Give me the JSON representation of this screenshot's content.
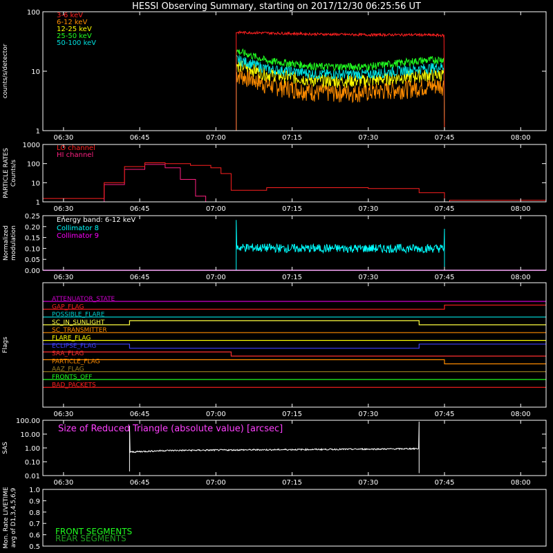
{
  "title": "HESSI Observing Summary, starting on 2017/12/30 06:25:56 UT",
  "time_axis_labels": [
    "06:30",
    "06:45",
    "07:00",
    "07:15",
    "07:30",
    "07:45",
    "08:00"
  ],
  "colors": {
    "background": "#000000",
    "axes": "#ffffff",
    "c3_6": "#ff2020",
    "c6_12": "#ff8c00",
    "c12_25": "#ffff00",
    "c25_50": "#20ff20",
    "c50_100": "#00e0e0",
    "lo": "#ff2020",
    "hi": "#ff2080",
    "coll8": "#00ffff",
    "coll9": "#ff00ff"
  },
  "chart_data": [
    {
      "type": "line",
      "panel": "count-rates",
      "title": "HESSI Observing Summary, starting on 2017/12/30 06:25:56 UT",
      "ylabel": "counts/s/detector",
      "yscale": "log",
      "ylim": [
        1,
        100
      ],
      "ytick_labels": [
        "1",
        "10",
        "100"
      ],
      "xlim": [
        "06:25:56",
        "08:05:00"
      ],
      "series": [
        {
          "name": "3-6 keV",
          "color": "#ff2020",
          "x": [
            "07:04",
            "07:10",
            "07:20",
            "07:30",
            "07:40",
            "07:45"
          ],
          "values": [
            45,
            44,
            42,
            41,
            41,
            40
          ]
        },
        {
          "name": "6-12 keV",
          "color": "#ff8c00",
          "x": [
            "07:04",
            "07:10",
            "07:20",
            "07:30",
            "07:40",
            "07:45"
          ],
          "values": [
            9,
            6,
            4.5,
            4.5,
            5.5,
            6
          ]
        },
        {
          "name": "12-25 keV",
          "color": "#ffff00",
          "x": [
            "07:04",
            "07:10",
            "07:20",
            "07:30",
            "07:40",
            "07:45"
          ],
          "values": [
            13,
            9,
            7,
            7,
            8.5,
            9
          ]
        },
        {
          "name": "25-50 keV",
          "color": "#20ff20",
          "x": [
            "07:04",
            "07:10",
            "07:20",
            "07:30",
            "07:40",
            "07:45"
          ],
          "values": [
            22,
            15,
            12,
            12,
            15,
            16
          ]
        },
        {
          "name": "50-100 keV",
          "color": "#00e0e0",
          "x": [
            "07:04",
            "07:10",
            "07:20",
            "07:30",
            "07:40",
            "07:45"
          ],
          "values": [
            16,
            11,
            9,
            9,
            11,
            12
          ]
        }
      ]
    },
    {
      "type": "line",
      "panel": "particle-rates",
      "ylabel": "PARTICLE RATES Counts/s",
      "yscale": "log",
      "ylim": [
        1,
        1000
      ],
      "ytick_labels": [
        "1",
        "10",
        "100",
        "1000"
      ],
      "series": [
        {
          "name": "LO channel",
          "color": "#ff2020",
          "x": [
            "06:26",
            "06:36",
            "06:38",
            "06:42",
            "06:46",
            "06:50",
            "06:55",
            "06:59",
            "07:01",
            "07:03",
            "07:10",
            "07:30",
            "07:40",
            "07:45",
            "07:46",
            "08:05"
          ],
          "values": [
            1.5,
            1.5,
            10,
            70,
            110,
            100,
            80,
            60,
            30,
            4,
            5.5,
            5,
            3,
            1,
            1.2,
            1.3
          ]
        },
        {
          "name": "HI channel",
          "color": "#ff2080",
          "x": [
            "06:26",
            "06:36",
            "06:38",
            "06:42",
            "06:46",
            "06:50",
            "06:53",
            "06:56",
            "06:58",
            "07:04",
            "07:45",
            "08:05"
          ],
          "values": [
            1,
            1,
            8,
            50,
            90,
            60,
            15,
            2,
            1,
            1,
            1,
            1
          ]
        }
      ]
    },
    {
      "type": "line",
      "panel": "modulation",
      "ylabel": "Normalized modulation",
      "ylim": [
        0,
        0.25
      ],
      "ytick_labels": [
        "0.00",
        "0.05",
        "0.10",
        "0.15",
        "0.20",
        "0.25"
      ],
      "annotation": "Energy band: 6-12 keV",
      "series": [
        {
          "name": "Collimator 8",
          "color": "#00ffff",
          "x": [
            "07:04",
            "07:15",
            "07:30",
            "07:45"
          ],
          "values": [
            0.105,
            0.1,
            0.1,
            0.1
          ]
        },
        {
          "name": "Collimator 9",
          "color": "#ff00ff",
          "x": [
            "06:26",
            "08:05"
          ],
          "values": [
            0,
            0
          ]
        }
      ]
    },
    {
      "type": "line",
      "panel": "flags",
      "ylabel": "Flags",
      "series": [
        {
          "name": "ATTENUATOR_STATE",
          "color": "#cc00cc",
          "x": [
            "06:26",
            "08:05"
          ],
          "values": [
            0,
            0
          ]
        },
        {
          "name": "GAP_FLAG",
          "color": "#ff2020",
          "x": [
            "06:26",
            "07:45",
            "07:45",
            "08:05"
          ],
          "values": [
            0,
            0,
            1,
            1
          ]
        },
        {
          "name": "POSSIBLE_FLARE",
          "color": "#00cccc",
          "x": [
            "06:26",
            "08:05"
          ],
          "values": [
            0,
            0
          ]
        },
        {
          "name": "SC_IN_SUNLIGHT",
          "color": "#ffff40",
          "x": [
            "06:26",
            "06:43",
            "06:43",
            "07:40",
            "07:40",
            "08:05"
          ],
          "values": [
            0,
            0,
            1,
            1,
            0,
            0
          ]
        },
        {
          "name": "SC_TRANSMITTER",
          "color": "#ff8c00",
          "x": [
            "06:26",
            "08:05"
          ],
          "values": [
            0,
            0
          ]
        },
        {
          "name": "FLARE_FLAG",
          "color": "#ffff00",
          "x": [
            "06:26",
            "08:05"
          ],
          "values": [
            0,
            0
          ]
        },
        {
          "name": "ECLIPSE_FLAG",
          "color": "#4040ff",
          "x": [
            "06:26",
            "06:43",
            "06:43",
            "07:40",
            "07:40",
            "08:05"
          ],
          "values": [
            1,
            1,
            0,
            0,
            1,
            1
          ]
        },
        {
          "name": "SAA_FLAG",
          "color": "#ff3030",
          "x": [
            "06:26",
            "07:03",
            "07:03",
            "08:05"
          ],
          "values": [
            1,
            1,
            0,
            0
          ]
        },
        {
          "name": "PARTICLE_FLAG",
          "color": "#ff8c00",
          "x": [
            "06:26",
            "07:45",
            "07:45",
            "08:05"
          ],
          "values": [
            1,
            1,
            0,
            0
          ]
        },
        {
          "name": "AAZ_FLAG",
          "color": "#a08020",
          "x": [
            "06:26",
            "08:05"
          ],
          "values": [
            0,
            0
          ]
        },
        {
          "name": "FRONTS_OFF",
          "color": "#20ff20",
          "x": [
            "06:26",
            "08:05"
          ],
          "values": [
            0,
            0
          ]
        },
        {
          "name": "BAD_PACKETS",
          "color": "#ff2020",
          "x": [
            "06:26",
            "08:05"
          ],
          "values": [
            0,
            0
          ]
        }
      ]
    },
    {
      "type": "line",
      "panel": "sas",
      "ylabel": "SAS",
      "yscale": "log",
      "ylim": [
        0.01,
        100
      ],
      "ytick_labels": [
        "0.01",
        "0.10",
        "1.00",
        "10.00",
        "100.00"
      ],
      "annotation": "Size of Reduced Triangle (absolute value) [arcsec]",
      "series": [
        {
          "color": "#ffffff",
          "x": [
            "06:43",
            "06:50",
            "07:05",
            "07:20",
            "07:35",
            "07:40"
          ],
          "values": [
            0.5,
            0.65,
            0.72,
            0.78,
            0.85,
            0.9
          ]
        }
      ]
    },
    {
      "type": "line",
      "panel": "livetime",
      "ylabel": "Mon. Rate LIVETIME avg of D1,3,4,5,6,9",
      "ylim": [
        0,
        1
      ],
      "ytick_labels": [
        "0.5",
        "0.6",
        "0.7",
        "0.8",
        "0.9",
        "1.0"
      ],
      "series": [
        {
          "name": "FRONT SEGMENTS",
          "color": "#20ff20",
          "x": [],
          "values": []
        },
        {
          "name": "REAR SEGMENTS",
          "color": "#20a020",
          "x": [],
          "values": []
        }
      ]
    }
  ]
}
